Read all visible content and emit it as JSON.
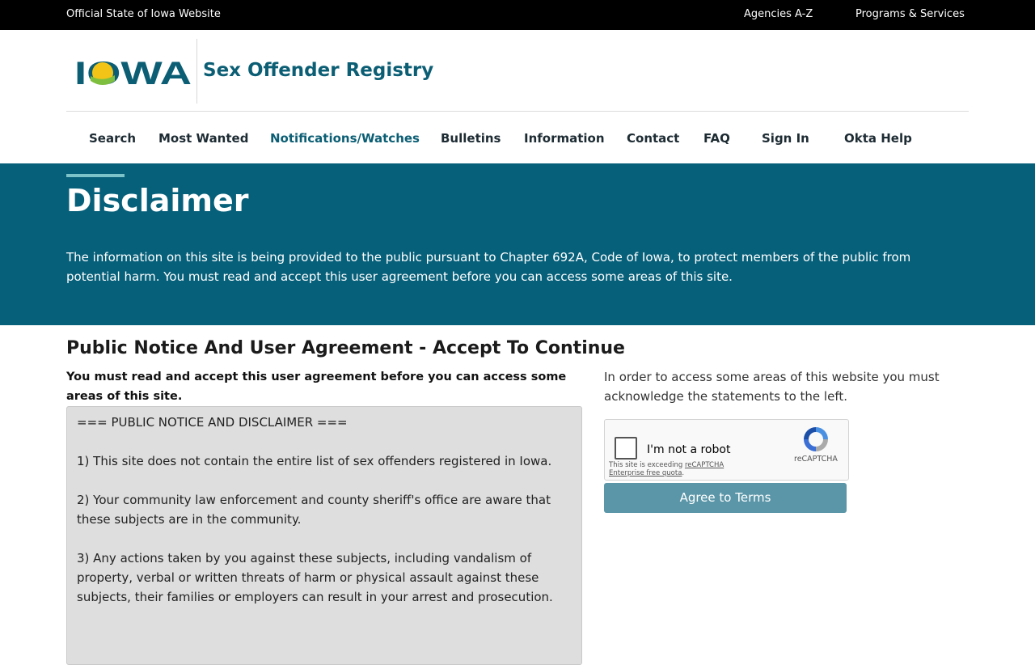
{
  "topbar": {
    "official": "Official State of Iowa Website",
    "agencies": "Agencies A-Z",
    "programs": "Programs & Services"
  },
  "brand": {
    "logo_text": "IOWA",
    "site_title": "Sex Offender Registry"
  },
  "nav": {
    "items": [
      {
        "label": "Search"
      },
      {
        "label": "Most Wanted"
      },
      {
        "label": "Notifications/Watches"
      },
      {
        "label": "Bulletins"
      },
      {
        "label": "Information"
      },
      {
        "label": "Contact"
      },
      {
        "label": "FAQ"
      },
      {
        "label": "Sign In"
      },
      {
        "label": "Okta Help"
      }
    ],
    "active": "Notifications/Watches"
  },
  "hero": {
    "title": "Disclaimer",
    "text": "The information on this site is being provided to the public pursuant to Chapter 692A, Code of Iowa, to protect members of the public from potential harm. You must read and accept this user agreement before you can access some areas of this site."
  },
  "agreement": {
    "section_title": "Public Notice And User Agreement - Accept To Continue",
    "note": "You must read and accept this user agreement before you can access some areas of this site.",
    "notice": {
      "heading": "=== PUBLIC NOTICE AND DISCLAIMER ===",
      "item1": "1) This site does not contain the entire list of sex offenders registered in Iowa.",
      "item2": "2) Your community law enforcement and county sheriff's office are aware that these subjects are in the community.",
      "item3": "3) Any actions taken by you against these subjects, including vandalism of property, verbal or written threats of harm or physical assault against these subjects, their families or employers can result in your arrest and prosecution."
    },
    "right_note": "In order to access some areas of this website you must acknowledge the statements to the left.",
    "captcha": {
      "label": "I'm not a robot",
      "quota_prefix": "This site is exceeding ",
      "quota_link": "reCAPTCHA Enterprise free quota",
      "quota_suffix": ".",
      "brand": "reCAPTCHA"
    },
    "button": "Agree to Terms"
  },
  "colors": {
    "brand": "#0b5e74",
    "hero": "#07607a",
    "accent": "#7cc3c9",
    "button": "#5a96a8",
    "logo_yellow": "#f2c417",
    "logo_green": "#7fbf3f"
  }
}
